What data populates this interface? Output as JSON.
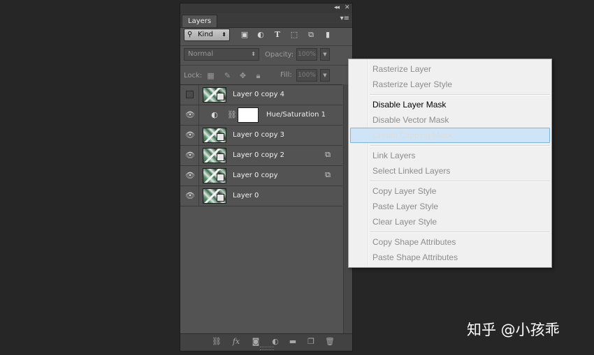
{
  "panel": {
    "tab": "Layers",
    "topbar_collapse": "◂◂",
    "topbar_close": "✕",
    "menu_icon": "▾≡",
    "filter": {
      "kind_label": "Kind",
      "icons": [
        "image-filter-icon",
        "adjustment-filter-icon",
        "type-filter-icon",
        "shape-filter-icon",
        "smart-object-filter-icon",
        "filter-toggle-icon"
      ]
    },
    "blend_mode": "Normal",
    "opacity_label": "Opacity:",
    "opacity_value": "100%",
    "lock_label": "Lock:",
    "fill_label": "Fill:",
    "fill_value": "100%"
  },
  "layers": [
    {
      "name": "Layer 0 copy 4",
      "visible": false,
      "type": "smart"
    },
    {
      "name": "Hue/Saturation 1",
      "visible": true,
      "type": "adjustment"
    },
    {
      "name": "Layer 0 copy 3",
      "visible": true,
      "type": "smart"
    },
    {
      "name": "Layer 0 copy 2",
      "visible": true,
      "type": "smart",
      "smart_badge": true
    },
    {
      "name": "Layer 0 copy",
      "visible": true,
      "type": "smart",
      "smart_badge": true
    },
    {
      "name": "Layer 0",
      "visible": true,
      "type": "smart"
    }
  ],
  "footer_icons": [
    "link-layers-icon",
    "fx-icon",
    "add-mask-icon",
    "adjustment-layer-icon",
    "new-group-icon",
    "new-layer-icon",
    "trash-icon"
  ],
  "context_menu": [
    {
      "label": "Rasterize Layer",
      "state": "disabled"
    },
    {
      "label": "Rasterize Layer Style",
      "state": "disabled"
    },
    {
      "label": "Disable Layer Mask",
      "state": "enabled"
    },
    {
      "label": "Disable Vector Mask",
      "state": "disabled"
    },
    {
      "label": "Create Clipping Mask",
      "state": "hover"
    },
    {
      "label": "Link Layers",
      "state": "disabled"
    },
    {
      "label": "Select Linked Layers",
      "state": "disabled"
    },
    {
      "label": "Copy Layer Style",
      "state": "disabled"
    },
    {
      "label": "Paste Layer Style",
      "state": "disabled"
    },
    {
      "label": "Clear Layer Style",
      "state": "disabled"
    },
    {
      "label": "Copy Shape Attributes",
      "state": "disabled"
    },
    {
      "label": "Paste Shape Attributes",
      "state": "disabled"
    }
  ],
  "watermark": "知乎 @小孩乖",
  "colors": {
    "background": "#262626",
    "panel": "#535353",
    "menu": "#f0f0f0",
    "menu_hover": "#cfe5f7"
  }
}
